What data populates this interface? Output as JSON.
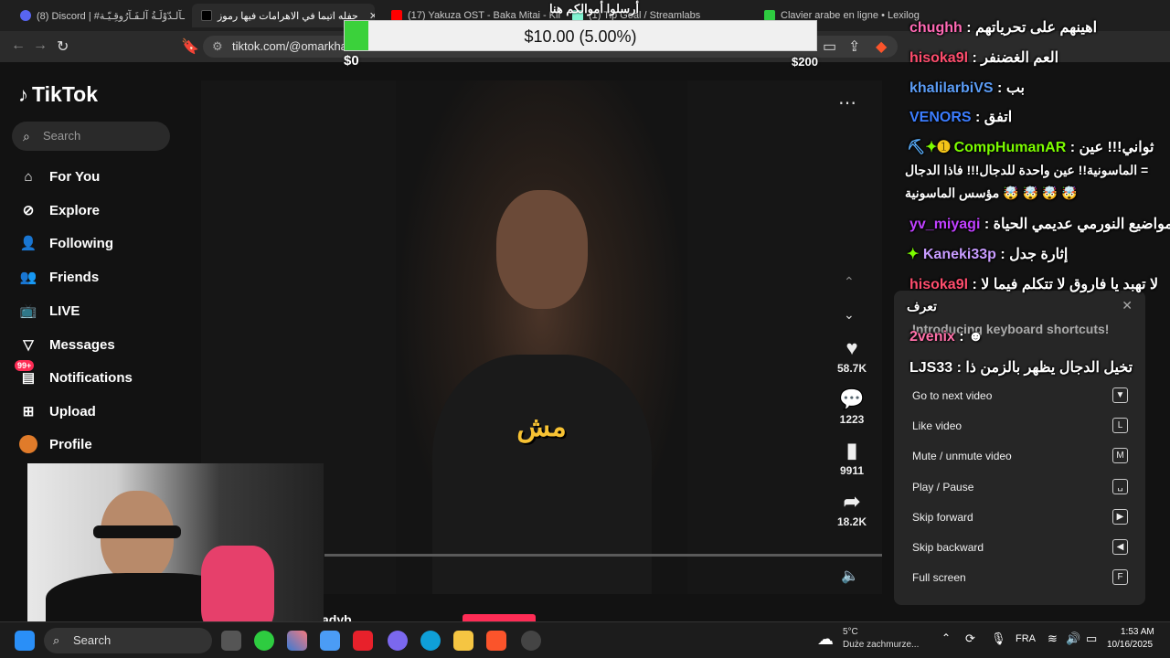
{
  "browser": {
    "tabs": [
      {
        "label": "(8) Discord | #ـآلـدّوْلَـةُ آلـفَـآرُوقِـيّـة",
        "color": "#5865f2"
      },
      {
        "label": "حفله اتيما في الاهرامات فيها رموز",
        "color": "#111111",
        "active": true
      },
      {
        "label": "(17) Yakuza OST - Baka Mitai - Kiryu",
        "color": "#ff0000"
      },
      {
        "label": "(1) Tip Goal / Streamlabs",
        "color": "#80f5d2"
      },
      {
        "label": "Clavier arabe en ligne • Lexilogos",
        "color": "#2ecc40"
      }
    ],
    "url": "tiktok.com/@omarkhale"
  },
  "donation": {
    "title": "أرسلوا أموالكم هنا",
    "text": "$10.00 (5.00%)",
    "percent": 5,
    "min": "$0",
    "max": "$200"
  },
  "tiktok": {
    "logo": "TikTok",
    "search_placeholder": "Search",
    "nav": [
      {
        "label": "For You",
        "icon": "home-icon"
      },
      {
        "label": "Explore",
        "icon": "compass-icon"
      },
      {
        "label": "Following",
        "icon": "following-icon"
      },
      {
        "label": "Friends",
        "icon": "friends-icon"
      },
      {
        "label": "LIVE",
        "icon": "live-icon"
      },
      {
        "label": "Messages",
        "icon": "messages-icon"
      },
      {
        "label": "Notifications",
        "icon": "notifications-icon",
        "badge": "99+"
      },
      {
        "label": "Upload",
        "icon": "upload-icon"
      },
      {
        "label": "Profile",
        "icon": "avatar-icon"
      }
    ],
    "caption": "مش",
    "actions": {
      "likes": "58.7K",
      "comments": "1223",
      "saves": "9911",
      "shares": "18.2K"
    },
    "author_partial": "adyb"
  },
  "chat": [
    {
      "user": "chughh",
      "msg": "اهينهم على تحرياتهم",
      "color": "#ff69b4"
    },
    {
      "user": "hisoka9l",
      "msg": "العم الغضنفر",
      "color": "#ff4d6d"
    },
    {
      "user": "khalilarbiVS",
      "msg": "بب",
      "color": "#5b9cf5"
    },
    {
      "user": "VENORS",
      "msg": "اتفق",
      "color": "#3c7dff"
    },
    {
      "user": "CompHumanAR",
      "msg": "ثواني!!! عين",
      "color": "#7cfc00"
    },
    {
      "user": "",
      "msg": "الماسونية!! عين واحدة للدجال!!! فاذا الدجال =",
      "color": "#ffffff"
    },
    {
      "user": "",
      "msg": "مؤسس الماسونية 🤯 🤯 🤯 🤯",
      "color": "#ffffff"
    },
    {
      "user": "yv_miyagi",
      "msg": "مواضيع النورمي عديمي الحياة",
      "color": "#c040ff"
    },
    {
      "user": "Kaneki33p",
      "msg": "إثارة جدل",
      "color": "#c89cff"
    },
    {
      "user": "hisoka9l",
      "msg": "لا تهبد يا فاروق لا تتكلم فيما لا",
      "color": "#ff4d6d"
    },
    {
      "user": "",
      "msg": "تعرف",
      "color": "#ffffff"
    },
    {
      "user": "2venix",
      "msg": "",
      "color": "#ff6fa8"
    },
    {
      "user": "LJS33",
      "msg": "تخيل الدجال يظهر بالزمن ذا",
      "color": "#ffffff"
    }
  ],
  "shortcuts": {
    "title": "Introducing keyboard shortcuts!",
    "items": [
      {
        "label": "Go to next video",
        "key": "▼"
      },
      {
        "label": "Like video",
        "key": "L"
      },
      {
        "label": "Mute / unmute video",
        "key": "M"
      },
      {
        "label": "Play / Pause",
        "key": "␣"
      },
      {
        "label": "Skip forward",
        "key": "▶"
      },
      {
        "label": "Skip backward",
        "key": "◀"
      },
      {
        "label": "Full screen",
        "key": "F"
      }
    ]
  },
  "taskbar": {
    "search": "Search",
    "weather_temp": "5°C",
    "weather_desc": "Duże zachmurze...",
    "lang": "FRA",
    "time": "1:53 AM",
    "date": "10/16/2025"
  }
}
